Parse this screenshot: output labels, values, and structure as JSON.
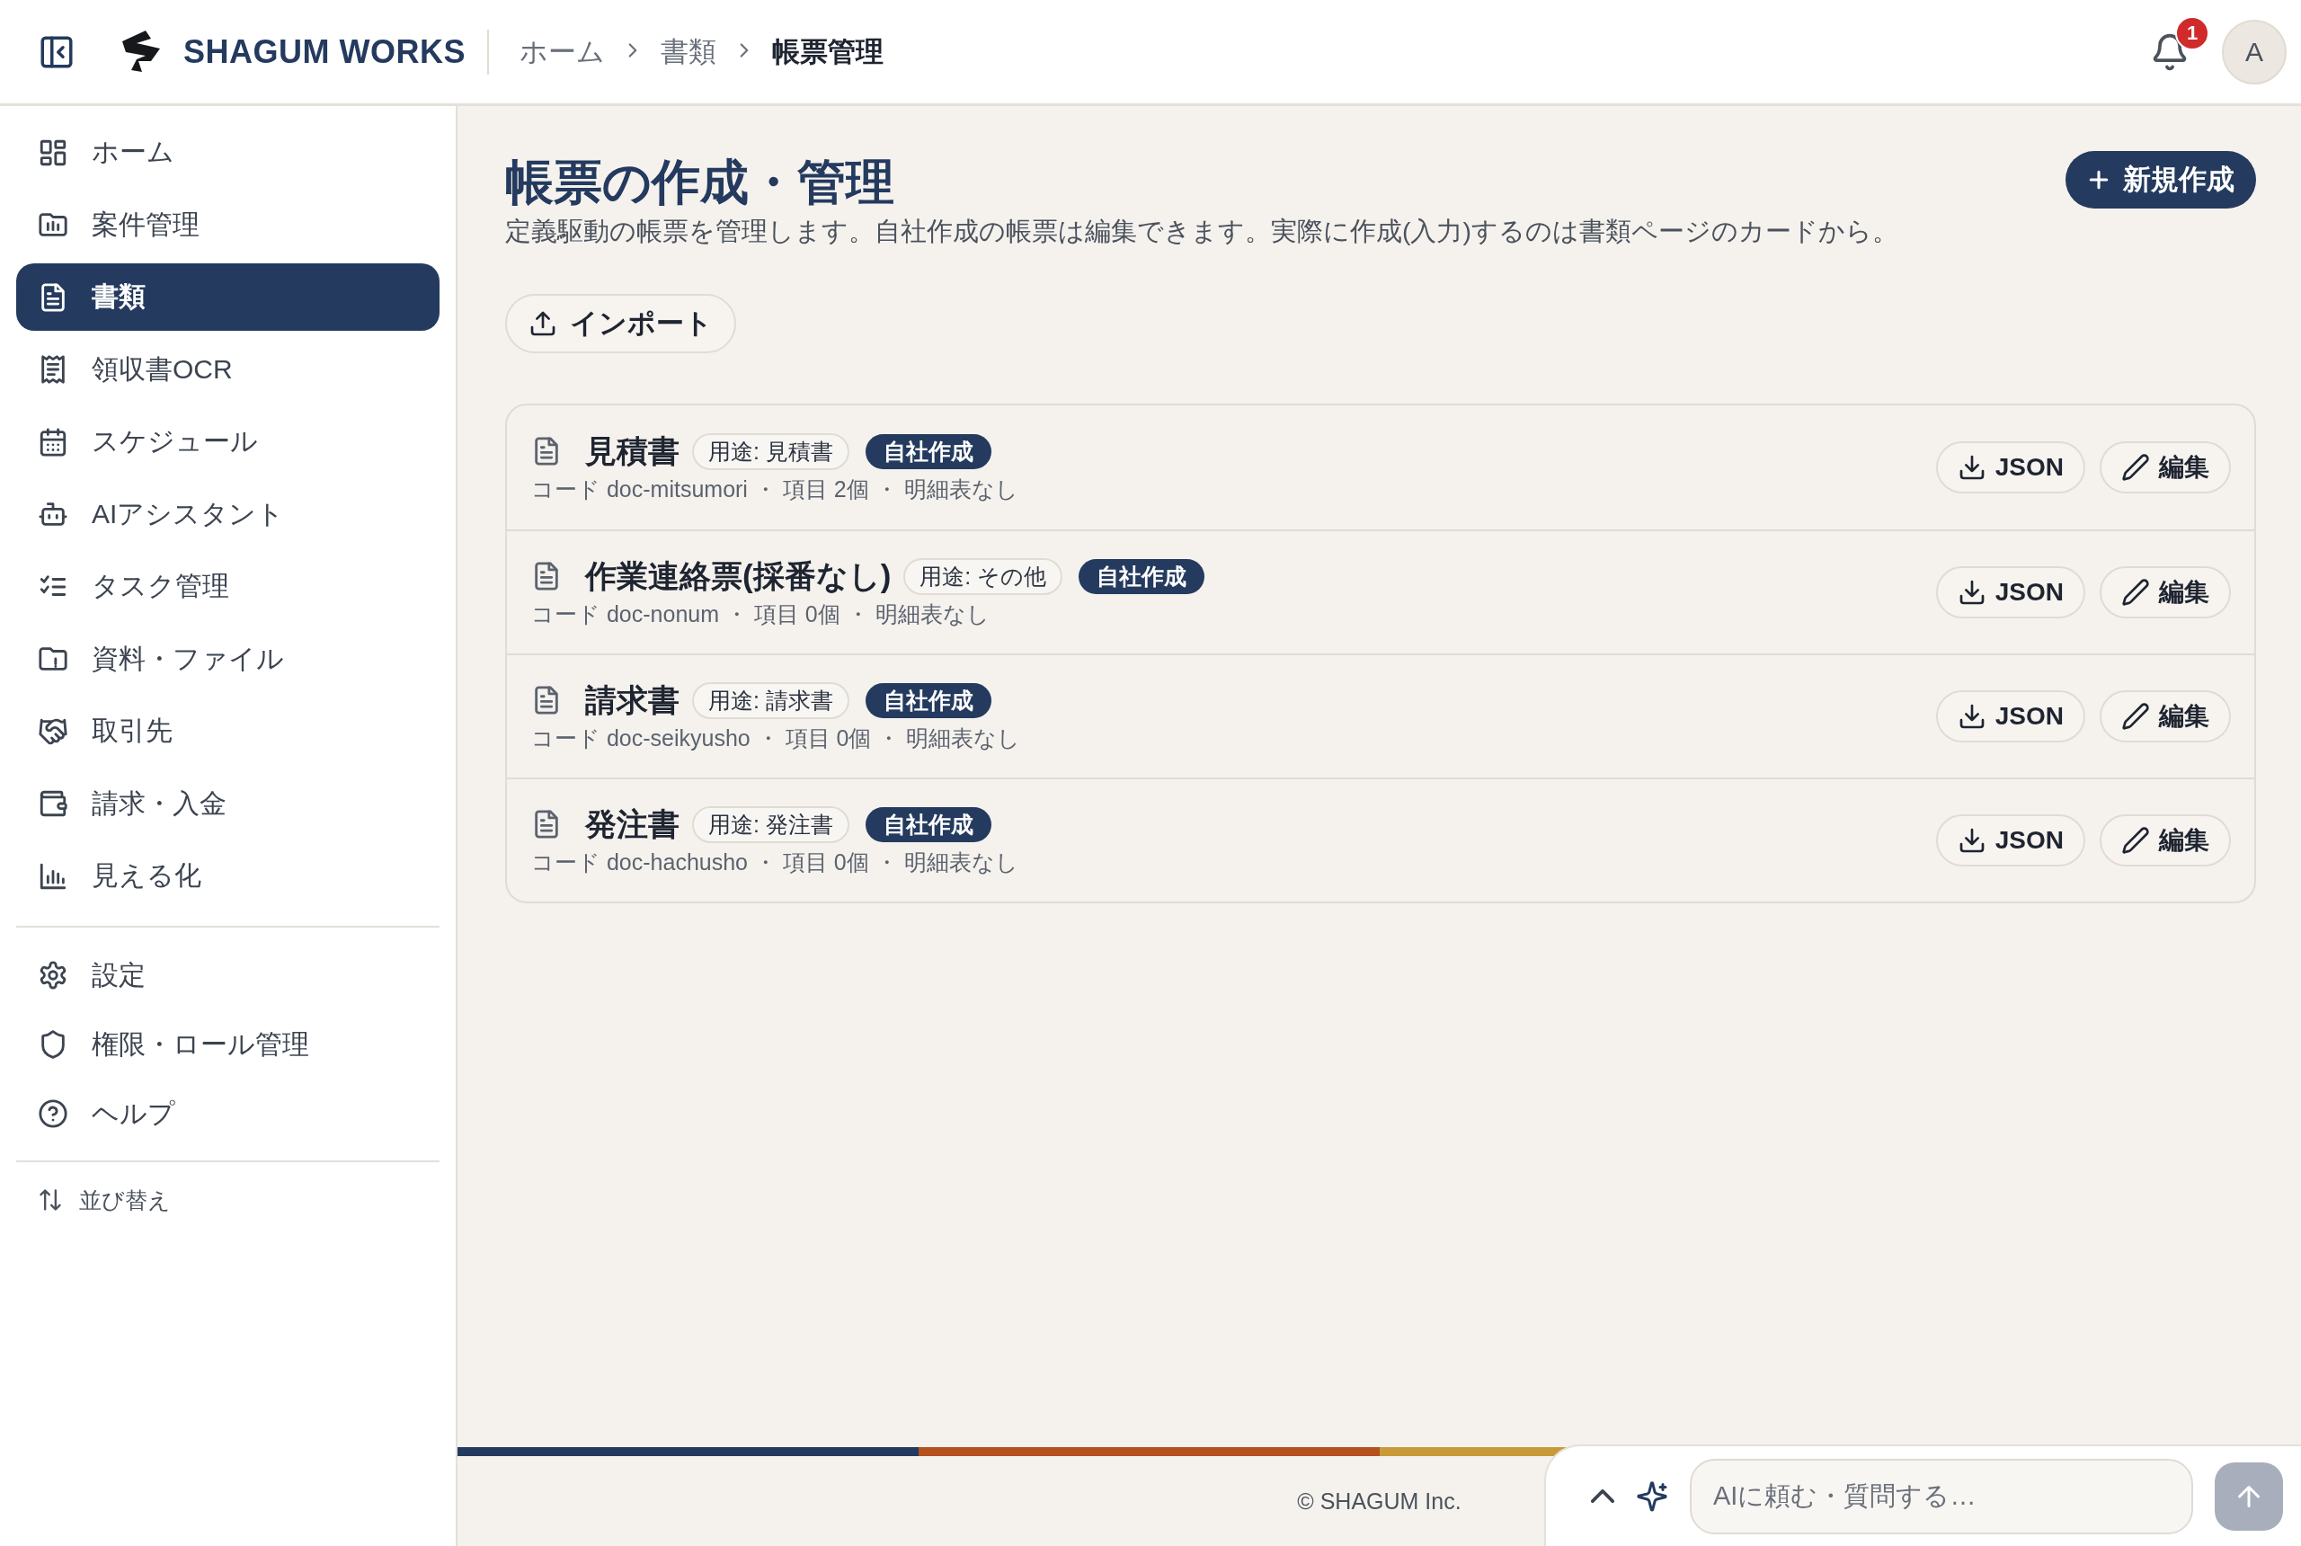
{
  "header": {
    "brand": "SHAGUM WORKS",
    "breadcrumb": [
      {
        "label": "ホーム",
        "current": false
      },
      {
        "label": "書類",
        "current": false
      },
      {
        "label": "帳票管理",
        "current": true
      }
    ],
    "notification_count": "1",
    "avatar": "A"
  },
  "sidebar": {
    "items": [
      {
        "label": "ホーム",
        "selected": false
      },
      {
        "label": "案件管理",
        "selected": false
      },
      {
        "label": "書類",
        "selected": true
      },
      {
        "label": "領収書OCR",
        "selected": false
      },
      {
        "label": "スケジュール",
        "selected": false
      },
      {
        "label": "AIアシスタント",
        "selected": false
      },
      {
        "label": "タスク管理",
        "selected": false
      },
      {
        "label": "資料・ファイル",
        "selected": false
      },
      {
        "label": "取引先",
        "selected": false
      },
      {
        "label": "請求・入金",
        "selected": false
      },
      {
        "label": "見える化",
        "selected": false
      }
    ],
    "admin_items": [
      {
        "label": "設定",
        "selected": false
      },
      {
        "label": "権限・ロール管理",
        "selected": false
      },
      {
        "label": "ヘルプ",
        "selected": false
      }
    ],
    "sort_label": "並び替え"
  },
  "page": {
    "title": "帳票の作成・管理",
    "description": "定義駆動の帳票を管理します。自社作成の帳票は編集できます。実際に作成(入力)するのは書類ページのカードから。",
    "new_button": "新規作成",
    "import_button": "インポート",
    "templates": [
      {
        "name": "見積書",
        "usage": "用途: 見積書",
        "badge": "自社作成",
        "meta": "コード doc-mitsumori ・ 項目 2個 ・ 明細表なし",
        "json_button": "JSON",
        "edit_button": "編集"
      },
      {
        "name": "作業連絡票(採番なし)",
        "usage": "用途: その他",
        "badge": "自社作成",
        "meta": "コード doc-nonum ・ 項目 0個 ・ 明細表なし",
        "json_button": "JSON",
        "edit_button": "編集"
      },
      {
        "name": "請求書",
        "usage": "用途: 請求書",
        "badge": "自社作成",
        "meta": "コード doc-seikyusho ・ 項目 0個 ・ 明細表なし",
        "json_button": "JSON",
        "edit_button": "編集"
      },
      {
        "name": "発注書",
        "usage": "用途: 発注書",
        "badge": "自社作成",
        "meta": "コード doc-hachusho ・ 項目 0個 ・ 明細表なし",
        "json_button": "JSON",
        "edit_button": "編集"
      }
    ]
  },
  "footer": {
    "copyright": "© SHAGUM Inc.",
    "ai_placeholder": "AIに頼む・質問する…"
  }
}
